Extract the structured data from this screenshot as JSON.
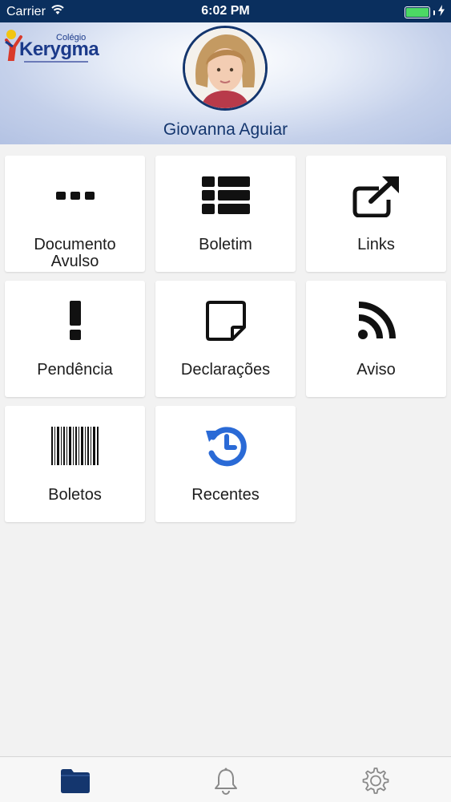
{
  "status_bar": {
    "carrier": "Carrier",
    "time": "6:02 PM",
    "battery_level": 1.0
  },
  "header": {
    "logo": {
      "school_prefix": "Colégio",
      "school_name": "Kerygma"
    },
    "student_name": "Giovanna Aguiar",
    "avatar_icon": "student-photo"
  },
  "menu": {
    "items": [
      {
        "label_line1": "Documento",
        "label_line2": "Avulso",
        "icon": "ellipsis-icon"
      },
      {
        "label": "Boletim",
        "icon": "list-icon"
      },
      {
        "label": "Links",
        "icon": "external-link-icon"
      },
      {
        "label": "Pendência",
        "icon": "exclamation-icon"
      },
      {
        "label": "Declarações",
        "icon": "sticky-note-icon"
      },
      {
        "label": "Aviso",
        "icon": "rss-icon"
      },
      {
        "label": "Boletos",
        "icon": "barcode-icon"
      },
      {
        "label": "Recentes",
        "icon": "history-icon"
      }
    ]
  },
  "tab_bar": {
    "tabs": [
      {
        "icon": "folder-icon",
        "active": true
      },
      {
        "icon": "bell-icon",
        "active": false
      },
      {
        "icon": "gear-icon",
        "active": false
      }
    ]
  },
  "colors": {
    "status_bar_bg": "#0a2f5e",
    "brand_blue": "#14366e",
    "accent_blue": "#2a6ad6",
    "battery": "#4cd964"
  }
}
